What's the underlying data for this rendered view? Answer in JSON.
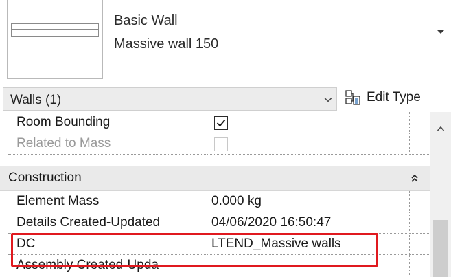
{
  "type_selector": {
    "family": "Basic Wall",
    "type_name": "Massive wall 150"
  },
  "instance_filter": {
    "label": "Walls (1)",
    "edit_type_label": "Edit Type"
  },
  "properties": {
    "constraints_rows": [
      {
        "name": "Room Bounding",
        "value_type": "checkbox",
        "checked": true,
        "enabled": true
      },
      {
        "name": "Related to Mass",
        "value_type": "checkbox",
        "checked": false,
        "enabled": false
      }
    ],
    "construction_group": {
      "label": "Construction",
      "rows": [
        {
          "name": "Element Mass",
          "value": "0.000 kg"
        },
        {
          "name": "Details Created-Updated",
          "value": "04/06/2020 16:50:47"
        },
        {
          "name": "DC",
          "value": "LTEND_Massive walls"
        },
        {
          "name": "Assembly Created-Upda",
          "value": ""
        }
      ]
    }
  },
  "colors": {
    "highlight": "#e0191f",
    "group_header": "#eaeaea",
    "disabled_text": "#9a9a9a"
  },
  "icons": [
    "chevron-down-icon",
    "edit-type-icon",
    "checkmark-icon",
    "collapse-group-icon",
    "scroll-up-icon"
  ]
}
